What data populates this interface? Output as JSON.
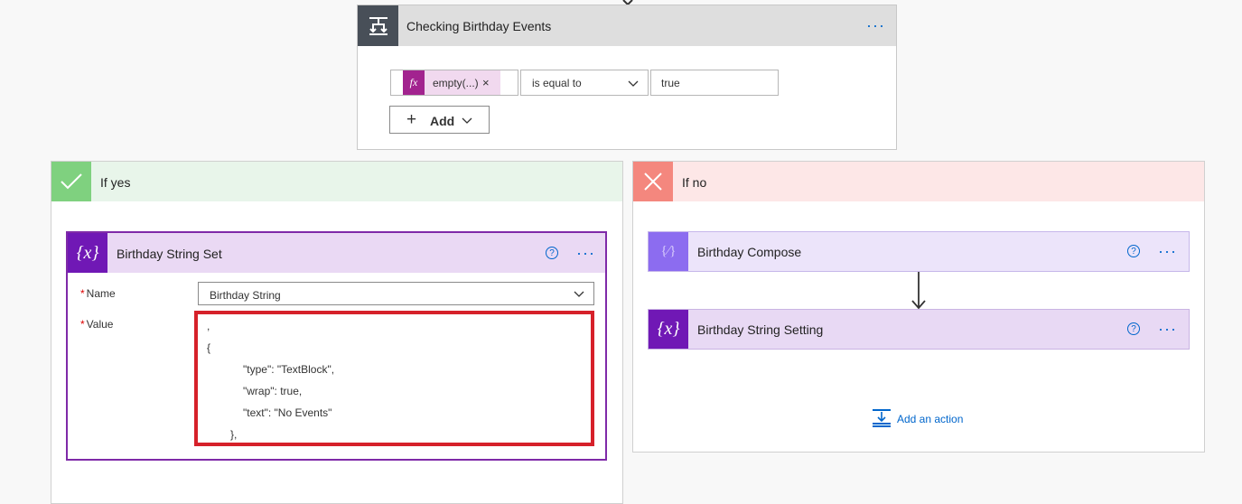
{
  "condition": {
    "title": "Checking Birthday Events",
    "token_icon": "fx-icon",
    "token_label": "empty(...)",
    "token_remove": "×",
    "operator": "is equal to",
    "value": "true",
    "add_label": "Add",
    "more_icon": "more-dots-icon"
  },
  "branch_yes": {
    "label": "If yes",
    "accent": "#7fd17f",
    "action": {
      "title": "Birthday String Set",
      "help": "?",
      "name_label": "Name",
      "name_value": "Birthday String",
      "value_label": "Value",
      "required_marker": "*",
      "value_lines": [
        ",",
        "{",
        "\"type\": \"TextBlock\",",
        "\"wrap\": true,",
        "\"text\": \"No Events\"",
        "},"
      ]
    }
  },
  "branch_no": {
    "label": "If no",
    "accent": "#f4877e",
    "actions": [
      {
        "title": "Birthday Compose",
        "help": "?"
      },
      {
        "title": "Birthday String Setting",
        "help": "?"
      }
    ],
    "add_action_label": "Add an action"
  },
  "colors": {
    "variable_purple": "#7018b5",
    "highlight_red": "#d6212a",
    "link_blue": "#0066cc"
  }
}
